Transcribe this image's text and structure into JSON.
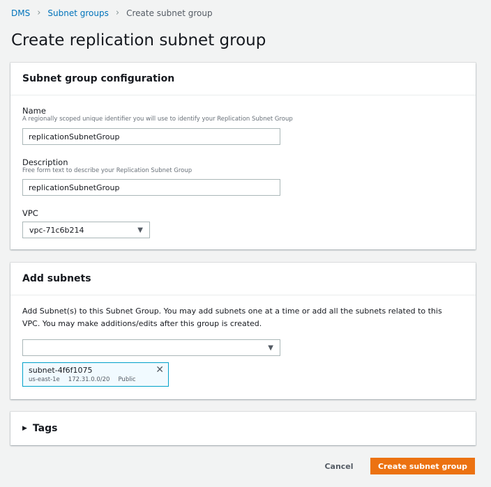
{
  "breadcrumb": {
    "items": [
      "DMS",
      "Subnet groups",
      "Create subnet group"
    ]
  },
  "page": {
    "title": "Create replication subnet group"
  },
  "config_panel": {
    "header": "Subnet group configuration",
    "name": {
      "label": "Name",
      "description": "A regionally scoped unique identifier you will use to identify your Replication Subnet Group",
      "value": "replicationSubnetGroup"
    },
    "description": {
      "label": "Description",
      "description": "Free form text to describe your Replication Subnet Group",
      "value": "replicationSubnetGroup"
    },
    "vpc": {
      "label": "VPC",
      "selected": "vpc-71c6b214"
    }
  },
  "subnets_panel": {
    "header": "Add subnets",
    "info": "Add Subnet(s) to this Subnet Group. You may add subnets one at a time or add all the subnets related to this VPC. You may make additions/edits after this group is created.",
    "select_value": "",
    "tokens": [
      {
        "name": "subnet-4f6f1075",
        "az": "us-east-1e",
        "cidr": "172.31.0.0/20",
        "type": "Public"
      }
    ]
  },
  "tags_panel": {
    "header": "Tags"
  },
  "actions": {
    "cancel": "Cancel",
    "create": "Create subnet group"
  },
  "colors": {
    "link": "#0073bb",
    "primary": "#ec7211",
    "token_border": "#00a1c9",
    "background": "#f2f3f3"
  }
}
